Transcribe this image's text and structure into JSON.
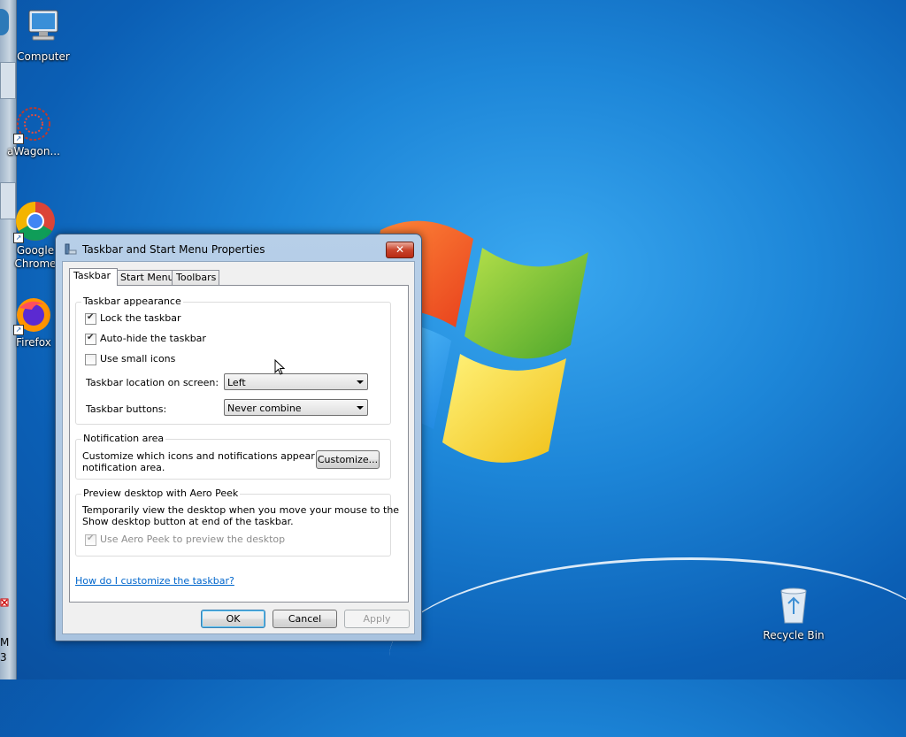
{
  "desktop": {
    "icons": [
      {
        "label": "Computer",
        "icon": "computer-icon"
      },
      {
        "label": "aWagon...",
        "icon": "app-icon"
      },
      {
        "label": "Google Chrome",
        "icon": "chrome-icon"
      },
      {
        "label": "Firefox",
        "icon": "firefox-icon"
      },
      {
        "label": "Recycle Bin",
        "icon": "recycle-bin-icon"
      }
    ]
  },
  "taskbar": {
    "position": "left",
    "clock_fragment_1": "M",
    "clock_fragment_2": "3"
  },
  "dialog": {
    "title": "Taskbar and Start Menu Properties",
    "close_label": "✕",
    "tabs": [
      {
        "label": "Taskbar",
        "active": true
      },
      {
        "label": "Start Menu",
        "active": false
      },
      {
        "label": "Toolbars",
        "active": false
      }
    ],
    "appearance": {
      "title": "Taskbar appearance",
      "lock_label": "Lock the taskbar",
      "lock_checked": true,
      "autohide_label": "Auto-hide the taskbar",
      "autohide_checked": true,
      "small_icons_label": "Use small icons",
      "small_icons_checked": false,
      "location_label": "Taskbar location on screen:",
      "location_value": "Left",
      "buttons_label": "Taskbar buttons:",
      "buttons_value": "Never combine"
    },
    "notification": {
      "title": "Notification area",
      "description_line1": "Customize which icons and notifications appear in the",
      "description_line2": "notification area.",
      "customize_label": "Customize..."
    },
    "peek": {
      "title": "Preview desktop with Aero Peek",
      "description_line1": "Temporarily view the desktop when you move your mouse to the",
      "description_line2": "Show desktop button at end of the taskbar.",
      "use_peek_label": "Use Aero Peek to preview the desktop",
      "use_peek_checked": true,
      "use_peek_enabled": false
    },
    "help_link": "How do I customize the taskbar?",
    "buttons": {
      "ok": "OK",
      "cancel": "Cancel",
      "apply": "Apply"
    }
  }
}
